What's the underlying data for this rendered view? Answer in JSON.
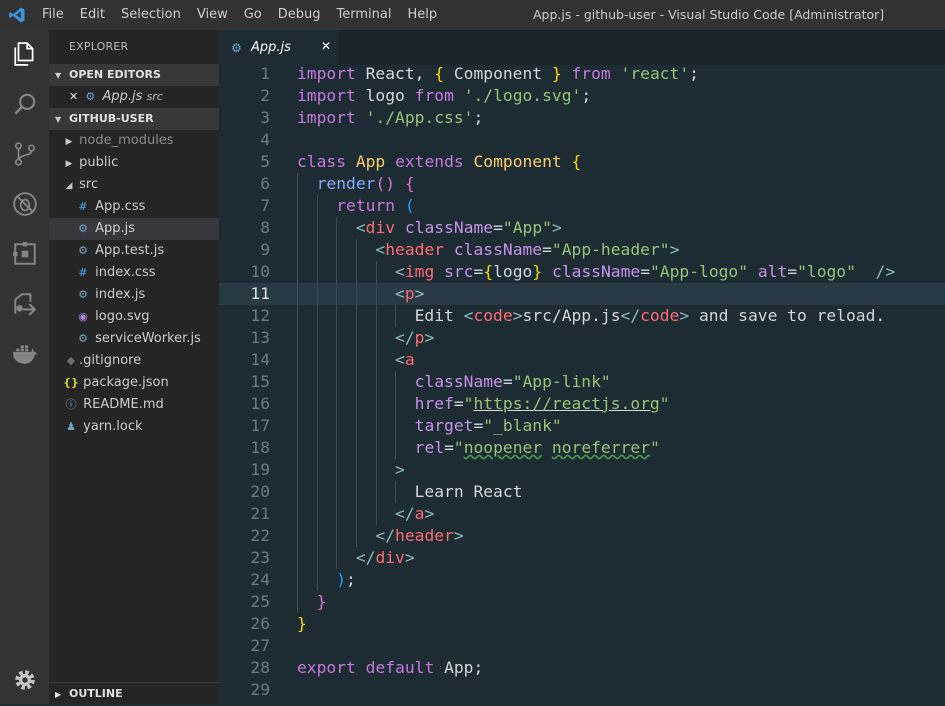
{
  "titlebar": {
    "menu": [
      "File",
      "Edit",
      "Selection",
      "View",
      "Go",
      "Debug",
      "Terminal",
      "Help"
    ],
    "title": "App.js - github-user - Visual Studio Code [Administrator]"
  },
  "activity_bar": [
    "explorer-icon",
    "search-icon",
    "source-control-icon",
    "debug-icon",
    "extensions-icon",
    "remote-icon",
    "docker-icon",
    "settings-icon"
  ],
  "sidebar": {
    "title": "EXPLORER",
    "open_editors": {
      "header": "OPEN EDITORS",
      "items": [
        {
          "close": "✕",
          "name": "App.js",
          "path": "src"
        }
      ]
    },
    "project": {
      "header": "GITHUB-USER",
      "items": [
        {
          "label": "node_modules",
          "type": "folder",
          "expanded": false
        },
        {
          "label": "public",
          "type": "folder",
          "expanded": false
        },
        {
          "label": "src",
          "type": "folder",
          "expanded": true
        },
        {
          "label": "App.css",
          "type": "css"
        },
        {
          "label": "App.js",
          "type": "js",
          "selected": true
        },
        {
          "label": "App.test.js",
          "type": "js"
        },
        {
          "label": "index.css",
          "type": "css"
        },
        {
          "label": "index.js",
          "type": "js"
        },
        {
          "label": "logo.svg",
          "type": "svg"
        },
        {
          "label": "serviceWorker.js",
          "type": "js"
        },
        {
          "label": ".gitignore",
          "type": "git"
        },
        {
          "label": "package.json",
          "type": "json"
        },
        {
          "label": "README.md",
          "type": "info"
        },
        {
          "label": "yarn.lock",
          "type": "yarn"
        }
      ]
    },
    "outline": "OUTLINE"
  },
  "editor": {
    "tab": {
      "name": "App.js",
      "close": "✕"
    },
    "current_line": 11,
    "line_numbers": [
      "1",
      "2",
      "3",
      "4",
      "5",
      "6",
      "7",
      "8",
      "9",
      "10",
      "11",
      "12",
      "13",
      "14",
      "15",
      "16",
      "17",
      "18",
      "19",
      "20",
      "21",
      "22",
      "23",
      "24",
      "25",
      "26",
      "27",
      "28",
      "29"
    ],
    "lines": [
      [
        [
          "k",
          "import"
        ],
        [
          "pl",
          " React, "
        ],
        [
          "br",
          "{"
        ],
        [
          "pl",
          " Component "
        ],
        [
          "br",
          "}"
        ],
        [
          "k",
          " from "
        ],
        [
          "s",
          "'react'"
        ],
        [
          "pl",
          ";"
        ]
      ],
      [
        [
          "k",
          "import"
        ],
        [
          "pl",
          " logo "
        ],
        [
          "k",
          "from"
        ],
        [
          "pl",
          " "
        ],
        [
          "s",
          "'./logo.svg'"
        ],
        [
          "pl",
          ";"
        ]
      ],
      [
        [
          "k",
          "import"
        ],
        [
          "pl",
          " "
        ],
        [
          "s",
          "'./App.css'"
        ],
        [
          "pl",
          ";"
        ]
      ],
      [],
      [
        [
          "k",
          "class"
        ],
        [
          "pl",
          " "
        ],
        [
          "p",
          "App"
        ],
        [
          "pl",
          " "
        ],
        [
          "k",
          "extends"
        ],
        [
          "pl",
          " "
        ],
        [
          "p",
          "Component"
        ],
        [
          "pl",
          " "
        ],
        [
          "br",
          "{"
        ]
      ],
      [
        [
          "pl",
          "  "
        ],
        [
          "fn",
          "render"
        ],
        [
          "br2",
          "()"
        ],
        [
          "pl",
          " "
        ],
        [
          "br2",
          "{"
        ]
      ],
      [
        [
          "pl",
          "    "
        ],
        [
          "k",
          "return"
        ],
        [
          "pl",
          " "
        ],
        [
          "br3",
          "("
        ]
      ],
      [
        [
          "pl",
          "      "
        ],
        [
          "gt",
          "<"
        ],
        [
          "tag",
          "div"
        ],
        [
          "pl",
          " "
        ],
        [
          "at",
          "className"
        ],
        [
          "pl",
          "="
        ],
        [
          "s",
          "\"App\""
        ],
        [
          "gt",
          ">"
        ]
      ],
      [
        [
          "pl",
          "        "
        ],
        [
          "gt",
          "<"
        ],
        [
          "tag",
          "header"
        ],
        [
          "pl",
          " "
        ],
        [
          "at",
          "className"
        ],
        [
          "pl",
          "="
        ],
        [
          "s",
          "\"App-header\""
        ],
        [
          "gt",
          ">"
        ]
      ],
      [
        [
          "pl",
          "          "
        ],
        [
          "gt",
          "<"
        ],
        [
          "tag",
          "img"
        ],
        [
          "pl",
          " "
        ],
        [
          "at",
          "src"
        ],
        [
          "pl",
          "="
        ],
        [
          "br",
          "{"
        ],
        [
          "pl",
          "logo"
        ],
        [
          "br",
          "}"
        ],
        [
          "pl",
          " "
        ],
        [
          "at",
          "className"
        ],
        [
          "pl",
          "="
        ],
        [
          "s",
          "\"App-logo\""
        ],
        [
          "pl",
          " "
        ],
        [
          "at",
          "alt"
        ],
        [
          "pl",
          "="
        ],
        [
          "s",
          "\"logo\""
        ],
        [
          "pl",
          "  "
        ],
        [
          "gt",
          "/>"
        ]
      ],
      [
        [
          "pl",
          "          "
        ],
        [
          "gt",
          "<"
        ],
        [
          "tag",
          "p"
        ],
        [
          "gt",
          ">"
        ]
      ],
      [
        [
          "pl",
          "            Edit "
        ],
        [
          "gt",
          "<"
        ],
        [
          "tag",
          "code"
        ],
        [
          "gt",
          ">"
        ],
        [
          "pl",
          "src/App.js"
        ],
        [
          "gt",
          "</"
        ],
        [
          "tag",
          "code"
        ],
        [
          "gt",
          ">"
        ],
        [
          "pl",
          " and save to reload."
        ]
      ],
      [
        [
          "pl",
          "          "
        ],
        [
          "gt",
          "</"
        ],
        [
          "tag",
          "p"
        ],
        [
          "gt",
          ">"
        ]
      ],
      [
        [
          "pl",
          "          "
        ],
        [
          "gt",
          "<"
        ],
        [
          "tag",
          "a"
        ]
      ],
      [
        [
          "pl",
          "            "
        ],
        [
          "at",
          "className"
        ],
        [
          "pl",
          "="
        ],
        [
          "s",
          "\"App-link\""
        ]
      ],
      [
        [
          "pl",
          "            "
        ],
        [
          "at",
          "href"
        ],
        [
          "pl",
          "="
        ],
        [
          "s",
          "\""
        ],
        [
          "sul",
          "https://reactjs.org"
        ],
        [
          "s",
          "\""
        ]
      ],
      [
        [
          "pl",
          "            "
        ],
        [
          "at",
          "target"
        ],
        [
          "pl",
          "="
        ],
        [
          "s",
          "\"_blank\""
        ]
      ],
      [
        [
          "pl",
          "            "
        ],
        [
          "at",
          "rel"
        ],
        [
          "pl",
          "="
        ],
        [
          "s",
          "\""
        ],
        [
          "ssq",
          "noopener"
        ],
        [
          "s",
          " "
        ],
        [
          "ssq",
          "noreferrer"
        ],
        [
          "s",
          "\""
        ]
      ],
      [
        [
          "pl",
          "          "
        ],
        [
          "gt",
          ">"
        ]
      ],
      [
        [
          "pl",
          "            Learn React"
        ]
      ],
      [
        [
          "pl",
          "          "
        ],
        [
          "gt",
          "</"
        ],
        [
          "tag",
          "a"
        ],
        [
          "gt",
          ">"
        ]
      ],
      [
        [
          "pl",
          "        "
        ],
        [
          "gt",
          "</"
        ],
        [
          "tag",
          "header"
        ],
        [
          "gt",
          ">"
        ]
      ],
      [
        [
          "pl",
          "      "
        ],
        [
          "gt",
          "</"
        ],
        [
          "tag",
          "div"
        ],
        [
          "gt",
          ">"
        ]
      ],
      [
        [
          "pl",
          "    "
        ],
        [
          "br3",
          ")"
        ],
        [
          "pl",
          ";"
        ]
      ],
      [
        [
          "pl",
          "  "
        ],
        [
          "br2",
          "}"
        ]
      ],
      [
        [
          "br",
          "}"
        ]
      ],
      [],
      [
        [
          "k",
          "export"
        ],
        [
          "pl",
          " "
        ],
        [
          "k",
          "default"
        ],
        [
          "pl",
          " App;"
        ]
      ],
      []
    ]
  },
  "colors": {
    "editor_bg": "#1d2b33",
    "sidebar_bg": "#252526",
    "activity_bg": "#333333",
    "titlebar_bg": "#323233"
  }
}
